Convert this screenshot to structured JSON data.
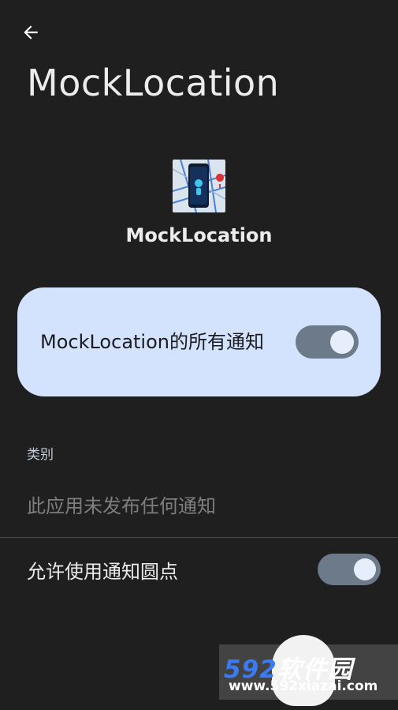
{
  "header": {
    "back_icon": "arrow-left-icon",
    "title": "MockLocation"
  },
  "app": {
    "icon": "app-phone-map-icon",
    "name": "MockLocation"
  },
  "master_toggle": {
    "label": "MockLocation的所有通知",
    "enabled": true
  },
  "categories": {
    "header": "类别",
    "empty_message": "此应用未发布任何通知"
  },
  "notification_dot": {
    "label": "允许使用通知圆点",
    "enabled": true
  },
  "watermark": {
    "brand_number": "592",
    "brand_text": "软件园",
    "url": "www.592xiazai.com"
  },
  "colors": {
    "background": "#1f1f1f",
    "card": "#d3e3fd",
    "switch_track": "#6c7a8a",
    "watermark_blue": "#3a7bf5"
  }
}
